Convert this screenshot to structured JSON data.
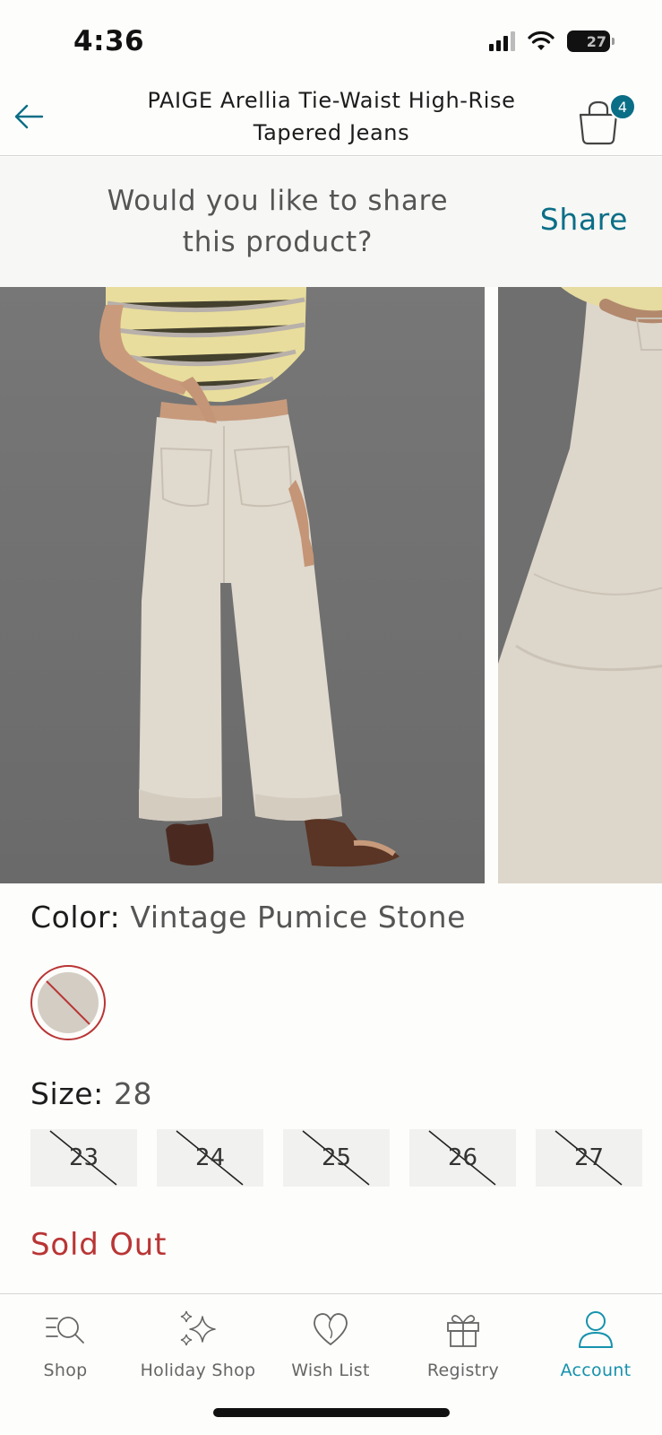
{
  "status_bar": {
    "time": "4:36",
    "battery": "27"
  },
  "header": {
    "title": "PAIGE Arellia Tie-Waist High-Rise Tapered Jeans",
    "bag_count": "4"
  },
  "share_banner": {
    "prompt": "Would you like to share this product?",
    "action": "Share"
  },
  "color": {
    "label": "Color:",
    "value": "Vintage Pumice Stone",
    "swatch_hex": "#d3cdc4"
  },
  "size": {
    "label": "Size:",
    "selected": "28",
    "options": [
      "23",
      "24",
      "25",
      "26",
      "27"
    ]
  },
  "availability": {
    "status": "Sold Out",
    "status_color": "#b93535"
  },
  "tab_bar": {
    "items": [
      {
        "label": "Shop",
        "icon": "shop-search-icon"
      },
      {
        "label": "Holiday Shop",
        "icon": "sparkles-icon"
      },
      {
        "label": "Wish List",
        "icon": "heart-icon"
      },
      {
        "label": "Registry",
        "icon": "gift-icon"
      },
      {
        "label": "Account",
        "icon": "person-icon"
      }
    ],
    "active": "Account",
    "accent": "#1592ad"
  }
}
